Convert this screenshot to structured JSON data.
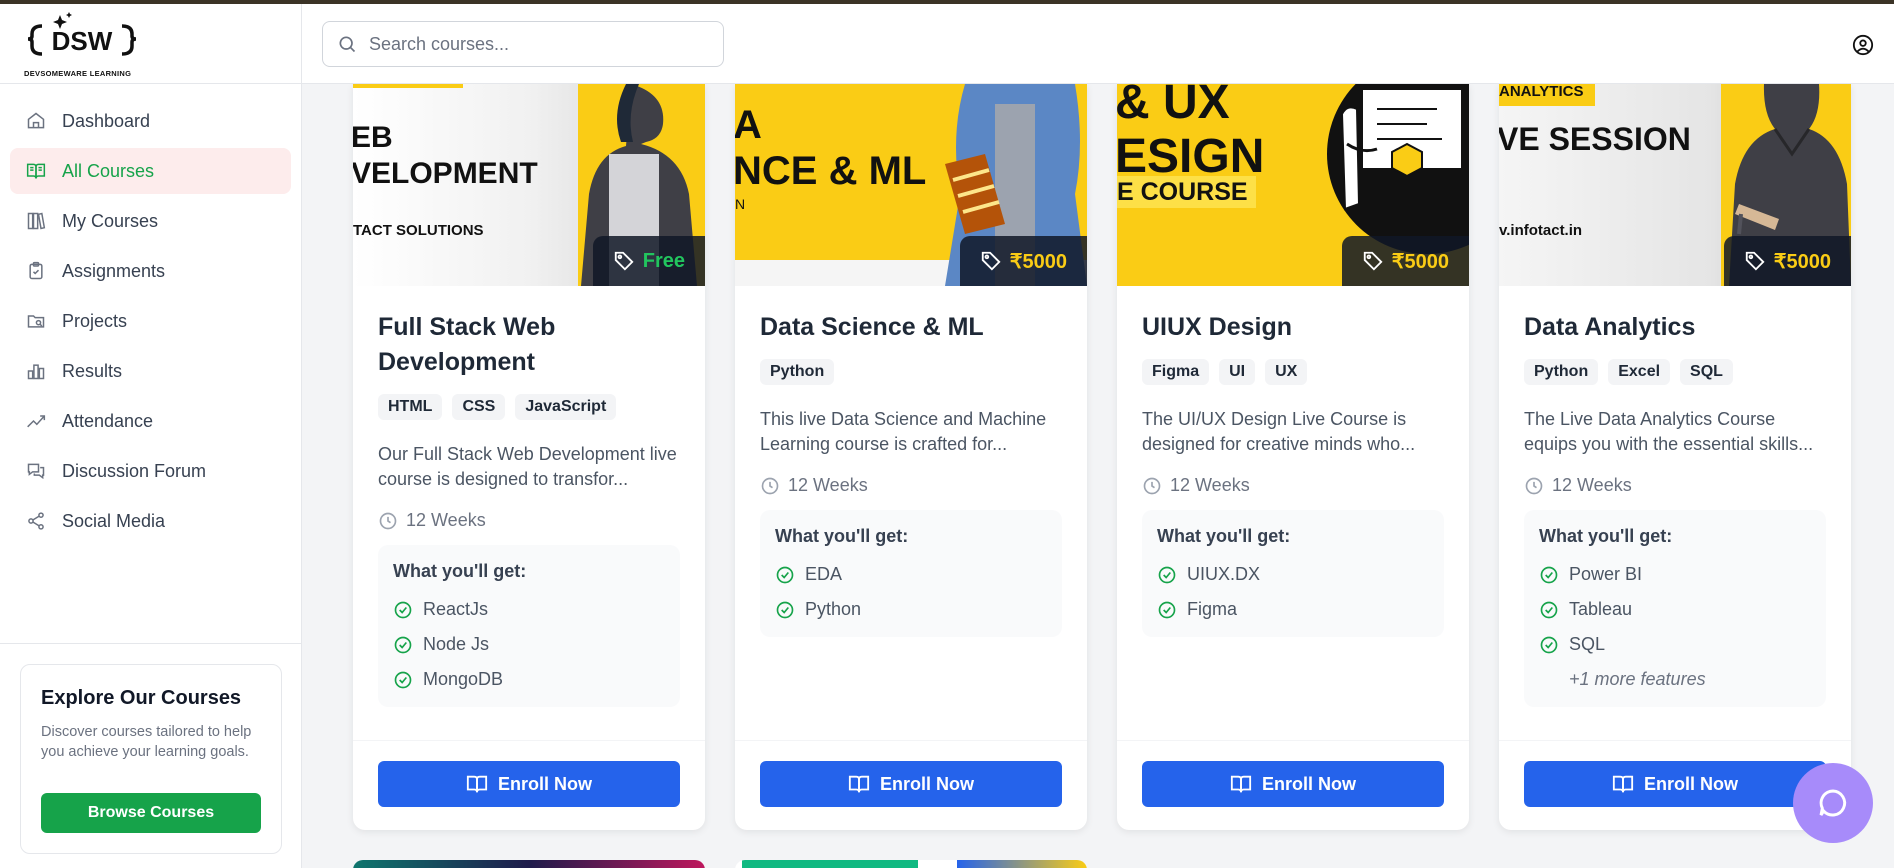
{
  "brand": {
    "logo_letters": "DSW",
    "name": "DEVSOMEWARE LEARNING"
  },
  "search": {
    "placeholder": "Search courses..."
  },
  "sidebar": {
    "items": [
      {
        "label": "Dashboard",
        "icon": "home-icon"
      },
      {
        "label": "All Courses",
        "icon": "book-open-icon",
        "active": true
      },
      {
        "label": "My Courses",
        "icon": "library-icon"
      },
      {
        "label": "Assignments",
        "icon": "clipboard-icon"
      },
      {
        "label": "Projects",
        "icon": "folder-icon"
      },
      {
        "label": "Results",
        "icon": "bar-chart-icon"
      },
      {
        "label": "Attendance",
        "icon": "trend-line-icon"
      },
      {
        "label": "Discussion Forum",
        "icon": "chat-icon"
      },
      {
        "label": "Social Media",
        "icon": "share-icon"
      }
    ]
  },
  "explore": {
    "title": "Explore Our Courses",
    "text": "Discover courses tailored to help you achieve your learning goals.",
    "button": "Browse Courses"
  },
  "courses": [
    {
      "banner_text": "EB\nVELOPMENT",
      "banner_sub": "TACT SOLUTIONS",
      "price": "Free",
      "title": "Full Stack Web Development",
      "tags": [
        "HTML",
        "CSS",
        "JavaScript"
      ],
      "description": "Our Full Stack Web Development live course is designed to transfor...",
      "duration": "12 Weeks",
      "features_title": "What you'll get:",
      "features": [
        "ReactJs",
        "Node Js",
        "MongoDB"
      ],
      "more": "",
      "enroll": "Enroll Now"
    },
    {
      "banner_text": "A\nNCE & ML",
      "banner_sub": "N",
      "price": "₹5000",
      "title": "Data Science & ML",
      "tags": [
        "Python"
      ],
      "description": "This live Data Science and Machine Learning course is crafted for...",
      "duration": "12 Weeks",
      "features_title": "What you'll get:",
      "features": [
        "EDA",
        "Python"
      ],
      "more": "",
      "enroll": "Enroll Now"
    },
    {
      "banner_text": "& UX\nESIGN",
      "banner_sub": "E COURSE",
      "price": "₹5000",
      "title": "UIUX Design",
      "tags": [
        "Figma",
        "UI",
        "UX"
      ],
      "description": "The UI/UX Design Live Course is designed for creative minds who...",
      "duration": "12 Weeks",
      "features_title": "What you'll get:",
      "features": [
        "UIUX.DX",
        "Figma"
      ],
      "more": "",
      "enroll": "Enroll Now"
    },
    {
      "banner_text": "VE SESSION",
      "banner_sub": "v.infotact.in",
      "banner_top": "ANALYTICS",
      "price": "₹5000",
      "title": "Data Analytics",
      "tags": [
        "Python",
        "Excel",
        "SQL"
      ],
      "description": "The Live Data Analytics Course equips you with the essential skills...",
      "duration": "12 Weeks",
      "features_title": "What you'll get:",
      "features": [
        "Power BI",
        "Tableau",
        "SQL"
      ],
      "more": "+1 more features",
      "enroll": "Enroll Now"
    }
  ],
  "colors": {
    "accent_green": "#16a34a",
    "primary_blue": "#2563eb",
    "price_yellow": "#facc15",
    "chat_purple": "#a78bfa"
  }
}
